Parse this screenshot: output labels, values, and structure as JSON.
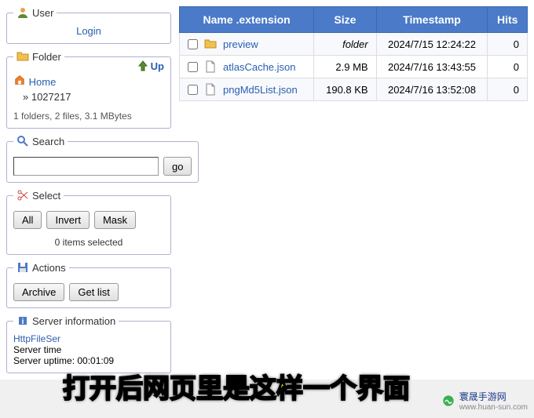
{
  "user": {
    "legend": "User",
    "login": "Login"
  },
  "folder": {
    "legend": "Folder",
    "up": "Up",
    "home": "Home",
    "current": "1027217",
    "stats": "1 folders, 2 files, 3.1 MBytes"
  },
  "search": {
    "legend": "Search",
    "go": "go",
    "placeholder": ""
  },
  "select": {
    "legend": "Select",
    "all": "All",
    "invert": "Invert",
    "mask": "Mask",
    "count": "0 items selected"
  },
  "actions": {
    "legend": "Actions",
    "archive": "Archive",
    "getlist": "Get list"
  },
  "server": {
    "legend": "Server information",
    "link": "HttpFileSer",
    "time_label": "Server time",
    "uptime_label": "Server uptime:",
    "uptime_value": "00:01:09"
  },
  "table": {
    "headers": {
      "name": "Name .extension",
      "size": "Size",
      "timestamp": "Timestamp",
      "hits": "Hits"
    },
    "rows": [
      {
        "name": "preview",
        "type": "folder",
        "size": "folder",
        "timestamp": "2024/7/15 12:24:22",
        "hits": "0"
      },
      {
        "name": "atlasCache.json",
        "type": "file",
        "size": "2.9 MB",
        "timestamp": "2024/7/16 13:43:55",
        "hits": "0"
      },
      {
        "name": "pngMd5List.json",
        "type": "file",
        "size": "190.8 KB",
        "timestamp": "2024/7/16 13:52:08",
        "hits": "0"
      }
    ]
  },
  "overlay": "打开后网页里是这样一个界面",
  "watermark": {
    "title": "寰晟手游网",
    "sub": "www.huan-sun.com"
  }
}
